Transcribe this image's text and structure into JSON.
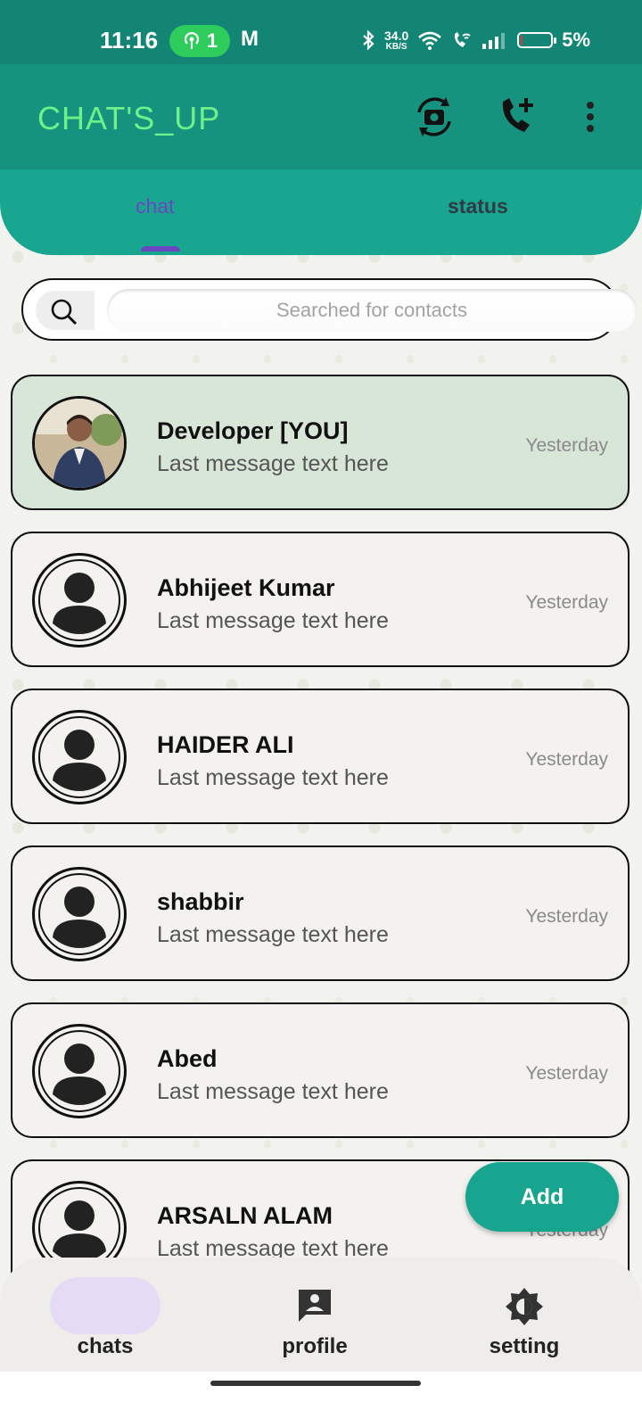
{
  "status_bar": {
    "time": "11:16",
    "hotspot_count": "1",
    "mail_indicator": "M",
    "net_speed_value": "34.0",
    "net_speed_unit": "KB/S",
    "battery": "5%",
    "battery_level": 0.05,
    "battery_color": "#e33333"
  },
  "app_bar": {
    "title": "CHAT'S_UP",
    "icons": [
      "camera-switch-icon",
      "add-call-icon",
      "more-vert-icon"
    ]
  },
  "tabs": [
    {
      "label": "chat",
      "selected": true
    },
    {
      "label": "status",
      "selected": false
    }
  ],
  "search": {
    "placeholder": "Searched for contacts",
    "value": ""
  },
  "chats": [
    {
      "name": "Developer [YOU]",
      "message": "Last message text here",
      "time": "Yesterday",
      "self": true
    },
    {
      "name": "Abhijeet Kumar",
      "message": "Last message text here",
      "time": "Yesterday"
    },
    {
      "name": "HAIDER ALI",
      "message": "Last message text here",
      "time": "Yesterday"
    },
    {
      "name": "shabbir",
      "message": "Last message text here",
      "time": "Yesterday"
    },
    {
      "name": "Abed",
      "message": "Last message text here",
      "time": "Yesterday"
    },
    {
      "name": "ARSALN ALAM",
      "message": "Last message text here",
      "time": "Yesterday"
    }
  ],
  "fab": {
    "label": "Add"
  },
  "bottom_nav": [
    {
      "label": "chats",
      "icon": "chat-bubble-icon",
      "selected": true
    },
    {
      "label": "profile",
      "icon": "profile-card-icon",
      "selected": false
    },
    {
      "label": "setting",
      "icon": "brightness-icon",
      "selected": false
    }
  ],
  "colors": {
    "status_bar": "#138575",
    "app_bar": "#16937f",
    "tab_bar": "#18a690",
    "title": "#6ef08a",
    "accent": "#6b46c1",
    "self_row": "#d8e6d8"
  }
}
